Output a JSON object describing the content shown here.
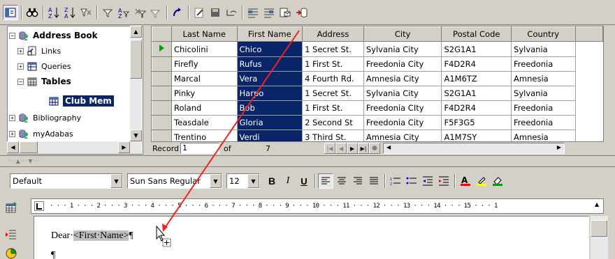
{
  "toolbar": {
    "icons": [
      "explorer-toggle-icon",
      "find-icon",
      "sort-ascending-icon",
      "sort-descending-icon",
      "autofilter-icon",
      "filter-icon",
      "standard-filter-icon",
      "remove-filter-icon",
      "apply-filter-icon",
      "refresh-icon",
      "edit-data-icon",
      "save-record-icon",
      "undo-record-icon",
      "data-to-text-icon",
      "data-to-fields-icon",
      "mail-merge-icon",
      "data-source-icon"
    ]
  },
  "tree": {
    "items": [
      {
        "label": "Address Book",
        "expander": "−"
      },
      {
        "label": "Links",
        "expander": "+"
      },
      {
        "label": "Queries",
        "expander": "+"
      },
      {
        "label": "Tables",
        "expander": "−"
      },
      {
        "label": "Club Mem"
      },
      {
        "label": "Bibliography",
        "expander": "+"
      },
      {
        "label": "myAdabas",
        "expander": "+"
      }
    ]
  },
  "grid": {
    "columns": [
      "Last Name",
      "First Name",
      "Address",
      "City",
      "Postal Code",
      "Country"
    ],
    "rows": [
      [
        "Chicolini",
        "Chico",
        "1 Secret St.",
        "Sylvania City",
        "S2G1A1",
        "Sylvania"
      ],
      [
        "Firefly",
        "Rufus",
        "1 First St.",
        "Freedonia City",
        "F4D2R4",
        "Freedonia"
      ],
      [
        "Marcal",
        "Vera",
        "4 Fourth Rd.",
        "Amnesia City",
        "A1M6TZ",
        "Amnesia"
      ],
      [
        "Pinky",
        "Harpo",
        "1 Secret St.",
        "Sylvania City",
        "S2G1A1",
        "Sylvania"
      ],
      [
        "Roland",
        "Bob",
        "1 First St.",
        "Freedonia CIty",
        "F4D2R4",
        "Freedonia"
      ],
      [
        "Teasdale",
        "Gloria",
        "2 Second St",
        "Freedonia City",
        "F5F3G5",
        "Freedonia"
      ],
      [
        "Trentino",
        "Verdi",
        "3 Third St.",
        "Amnesia City",
        "A1M7SY",
        "Amnesia"
      ]
    ],
    "record_label": "Record",
    "record_value": "1",
    "of_label": "of",
    "total": "7"
  },
  "format": {
    "style": "Default",
    "font": "Sun Sans Regular",
    "size": "12",
    "bold": "B",
    "italic": "I",
    "underline": "U"
  },
  "ruler": {
    "text": "· · · 1 · · · 2 · · · 3 · · · 4 · · · 5 · · · 6 · · · 7 · · · 8 · · · 9 · · · 10 · · · 11 · · · 12 · · · 13 · · · 14 · · · 15 · · · 1"
  },
  "document": {
    "prefix": "Dear·",
    "field": "<First·Name>",
    "suffix": "¶",
    "line2": "¶"
  },
  "colors": {
    "selection": "#0a246a",
    "drag_arrow": "#e8261e",
    "accent_blue": "#0000ff"
  }
}
